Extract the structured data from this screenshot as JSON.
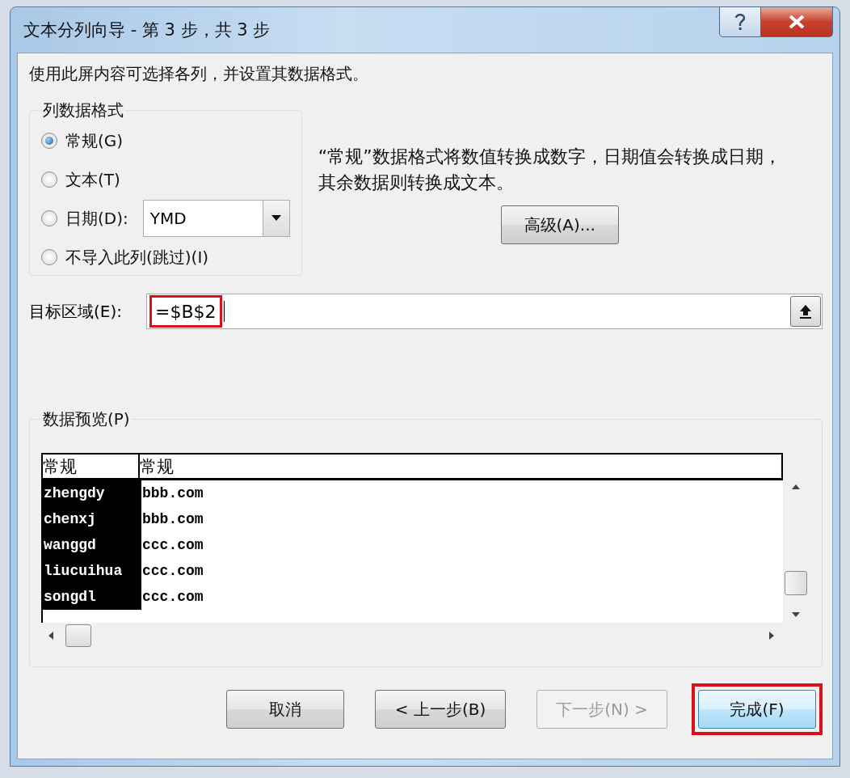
{
  "window": {
    "title": "文本分列向导 - 第 3 步，共 3 步"
  },
  "instruction": "使用此屏内容可选择各列，并设置其数据格式。",
  "format_group": {
    "title": "列数据格式",
    "options": [
      {
        "label": "常规(G)",
        "selected": true,
        "kind": "radio"
      },
      {
        "label": "文本(T)",
        "selected": false,
        "kind": "radio"
      },
      {
        "label": "日期(D):",
        "selected": false,
        "kind": "date"
      },
      {
        "label": "不导入此列(跳过)(I)",
        "selected": false,
        "kind": "radio"
      }
    ],
    "date_format": "YMD"
  },
  "description": "“常规”数据格式将数值转换成数字，日期值会转换成日期，其余数据则转换成文本。",
  "advanced_button": "高级(A)...",
  "destination": {
    "label": "目标区域(E):",
    "value": "=$B$2",
    "highlighted": true
  },
  "preview": {
    "title": "数据预览(P)",
    "columns": [
      {
        "header": "常规",
        "selected": true
      },
      {
        "header": "常规",
        "selected": false
      }
    ],
    "rows": [
      [
        "zhengdy",
        "bbb.com"
      ],
      [
        "chenxj",
        "bbb.com"
      ],
      [
        "wanggd",
        "ccc.com"
      ],
      [
        "liucuihua",
        "ccc.com"
      ],
      [
        "songdl",
        "ccc.com"
      ]
    ]
  },
  "buttons": [
    {
      "label": "取消",
      "disabled": false,
      "highlighted": false
    },
    {
      "label": "< 上一步(B)",
      "disabled": false,
      "highlighted": false
    },
    {
      "label": "下一步(N) >",
      "disabled": true,
      "highlighted": false
    },
    {
      "label": "完成(F)",
      "disabled": false,
      "highlighted": true
    }
  ]
}
